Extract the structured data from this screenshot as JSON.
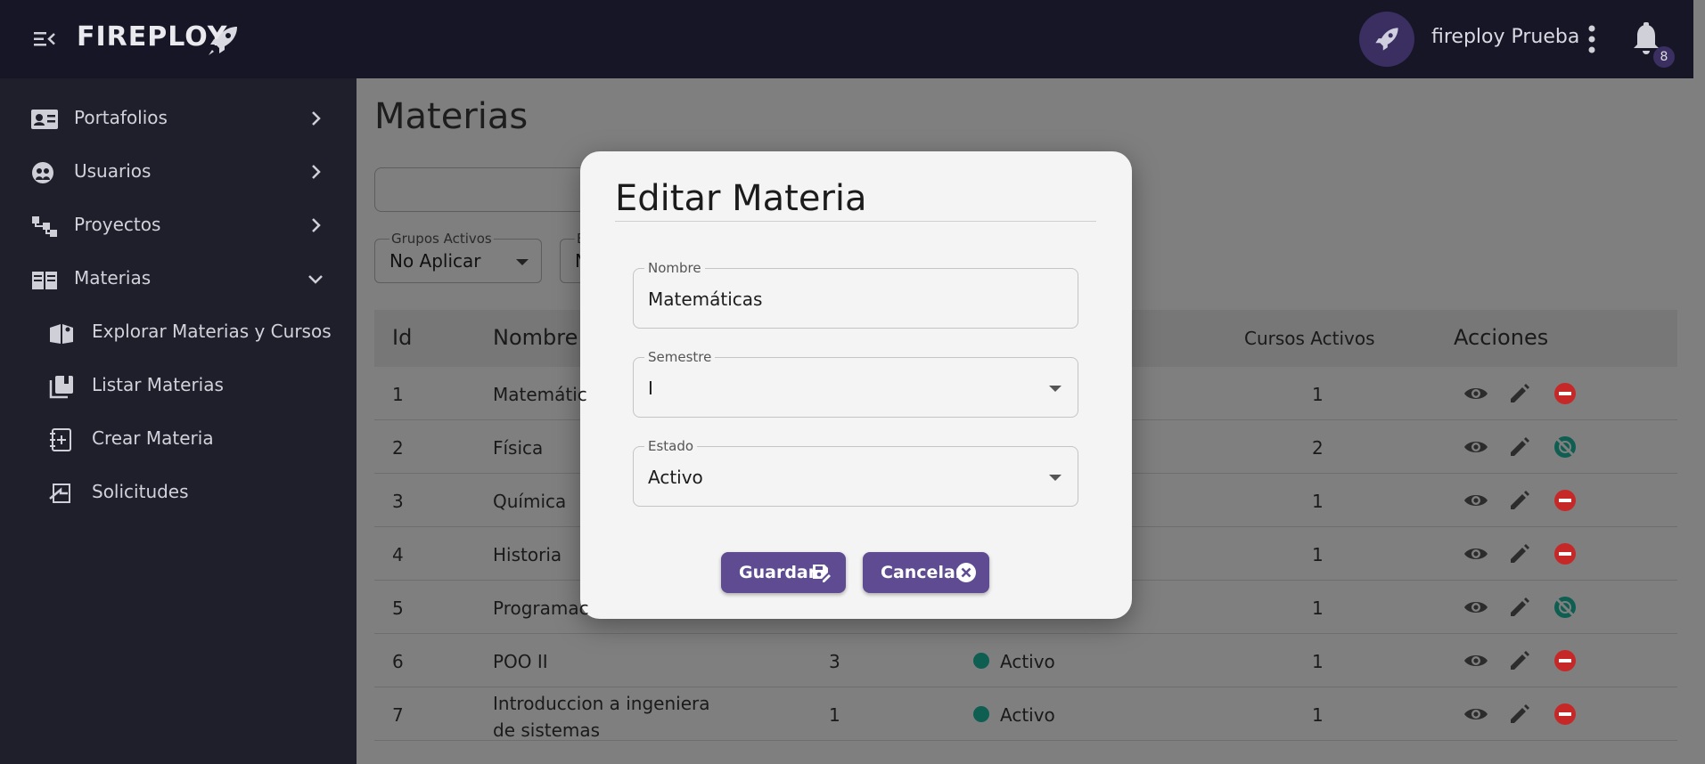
{
  "app": {
    "brand": "FIREPLOY",
    "username": "fireploy Prueba",
    "notifications": "8"
  },
  "sidebar": {
    "items": [
      {
        "label": "Portafolios"
      },
      {
        "label": "Usuarios"
      },
      {
        "label": "Proyectos"
      },
      {
        "label": "Materias"
      }
    ],
    "subitems": [
      {
        "label": "Explorar Materias y Cursos"
      },
      {
        "label": "Listar Materias"
      },
      {
        "label": "Crear Materia"
      },
      {
        "label": "Solicitudes"
      }
    ]
  },
  "page": {
    "title": "Materias",
    "filters": [
      {
        "label": "Grupos Activos",
        "value": "No Aplicar"
      },
      {
        "label": "E",
        "value": "N"
      }
    ]
  },
  "table": {
    "headers": {
      "id": "Id",
      "nombre": "Nombre",
      "cursos": "Cursos Activos",
      "acciones": "Acciones"
    },
    "rows": [
      {
        "id": "1",
        "nombre": "Matemátic",
        "semestre": "",
        "estado": "",
        "cursos": "1",
        "toggle": "disable"
      },
      {
        "id": "2",
        "nombre": "Física",
        "semestre": "",
        "estado": "",
        "cursos": "2",
        "toggle": "enable"
      },
      {
        "id": "3",
        "nombre": "Química",
        "semestre": "",
        "estado": "",
        "cursos": "1",
        "toggle": "disable"
      },
      {
        "id": "4",
        "nombre": "Historia",
        "semestre": "",
        "estado": "",
        "cursos": "1",
        "toggle": "disable"
      },
      {
        "id": "5",
        "nombre": "Programac",
        "semestre": "",
        "estado": "",
        "cursos": "1",
        "toggle": "enable"
      },
      {
        "id": "6",
        "nombre": "POO II",
        "semestre": "3",
        "estado": "Activo",
        "cursos": "1",
        "toggle": "disable"
      },
      {
        "id": "7",
        "nombre": "Introduccion a ingeniera",
        "nombre2": "de sistemas",
        "semestre": "1",
        "estado": "Activo",
        "cursos": "1",
        "toggle": "disable"
      }
    ]
  },
  "modal": {
    "title": "Editar Materia",
    "fields": {
      "nombre": {
        "label": "Nombre",
        "value": "Matemáticas"
      },
      "semestre": {
        "label": "Semestre",
        "value": "I"
      },
      "estado": {
        "label": "Estado",
        "value": "Activo"
      }
    },
    "save_label": "Guardar",
    "cancel_label": "Cancelar"
  },
  "colors": {
    "accent": "#5e4b91",
    "danger": "#c62828",
    "success": "#0f5e52"
  }
}
